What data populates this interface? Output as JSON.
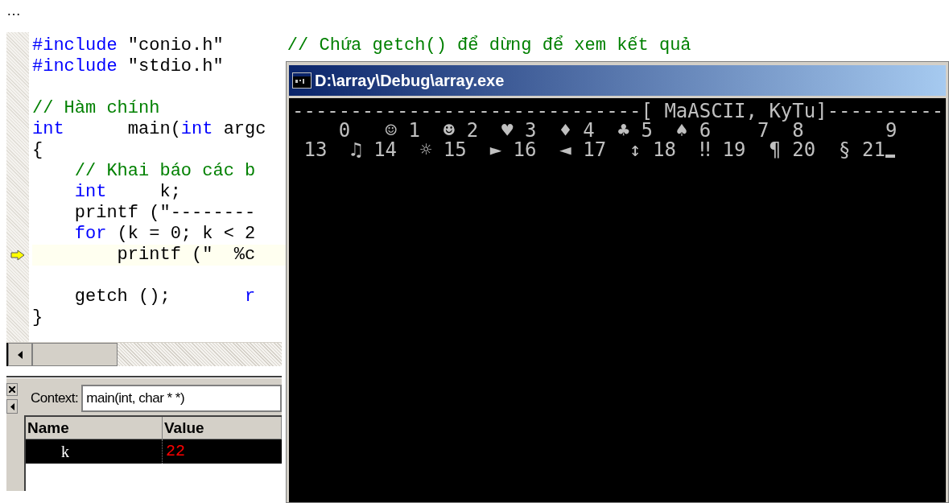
{
  "page_header": "…",
  "editor": {
    "lines": [
      {
        "current": false,
        "segments": [
          {
            "kind": "keyword",
            "text": "#include"
          },
          {
            "kind": "plain",
            "text": " \"conio.h\"      "
          },
          {
            "kind": "comment",
            "text": "// Chứa getch() để dừng để xem kết quả"
          }
        ]
      },
      {
        "current": false,
        "segments": [
          {
            "kind": "keyword",
            "text": "#include"
          },
          {
            "kind": "plain",
            "text": " \"stdio.h\""
          }
        ]
      },
      {
        "current": false
      },
      {
        "current": false,
        "segments": [
          {
            "kind": "comment",
            "text": "// Hàm chính"
          }
        ]
      },
      {
        "current": false,
        "segments": [
          {
            "kind": "keyword",
            "text": "int"
          },
          {
            "kind": "plain",
            "text": "      main("
          },
          {
            "kind": "keyword",
            "text": "int"
          },
          {
            "kind": "plain",
            "text": " argc"
          }
        ]
      },
      {
        "current": false,
        "segments": [
          {
            "kind": "plain",
            "text": "{"
          }
        ]
      },
      {
        "current": false,
        "segments": [
          {
            "kind": "comment",
            "text": "    // Khai báo các b"
          }
        ]
      },
      {
        "current": false,
        "segments": [
          {
            "kind": "keyword",
            "text": "    int"
          },
          {
            "kind": "plain",
            "text": "     k;"
          }
        ]
      },
      {
        "current": false,
        "segments": [
          {
            "kind": "plain",
            "text": "    printf (\"--------"
          }
        ]
      },
      {
        "current": false,
        "segments": [
          {
            "kind": "keyword",
            "text": "    for"
          },
          {
            "kind": "plain",
            "text": " (k = 0; k < 2"
          }
        ]
      },
      {
        "current": true,
        "segments": [
          {
            "kind": "plain",
            "text": "        printf (\"  %c"
          }
        ]
      },
      {
        "current": false
      },
      {
        "current": false,
        "segments": [
          {
            "kind": "plain",
            "text": "    getch ();       "
          },
          {
            "kind": "keyword",
            "text": "r"
          }
        ]
      },
      {
        "current": false,
        "segments": [
          {
            "kind": "plain",
            "text": "}"
          }
        ]
      }
    ]
  },
  "variables": {
    "context_label": "Context:",
    "context_value": "main(int, char * *)",
    "columns": [
      "Name",
      "Value"
    ],
    "rows": [
      {
        "name": "k",
        "value": "22",
        "selected": true,
        "changed": true
      }
    ]
  },
  "console": {
    "title": "D:\\array\\Debug\\array.exe",
    "lines": [
      "------------------------------[ MaASCII, KyTu]----------",
      "    0   ☺ 1  ☻ 2  ♥ 3  ♦ 4  ♣ 5  ♠ 6    7  8       9",
      " 13  ♫ 14  ☼ 15  ► 16  ◄ 17  ↕ 18  ‼ 19  ¶ 20  § 21"
    ]
  }
}
